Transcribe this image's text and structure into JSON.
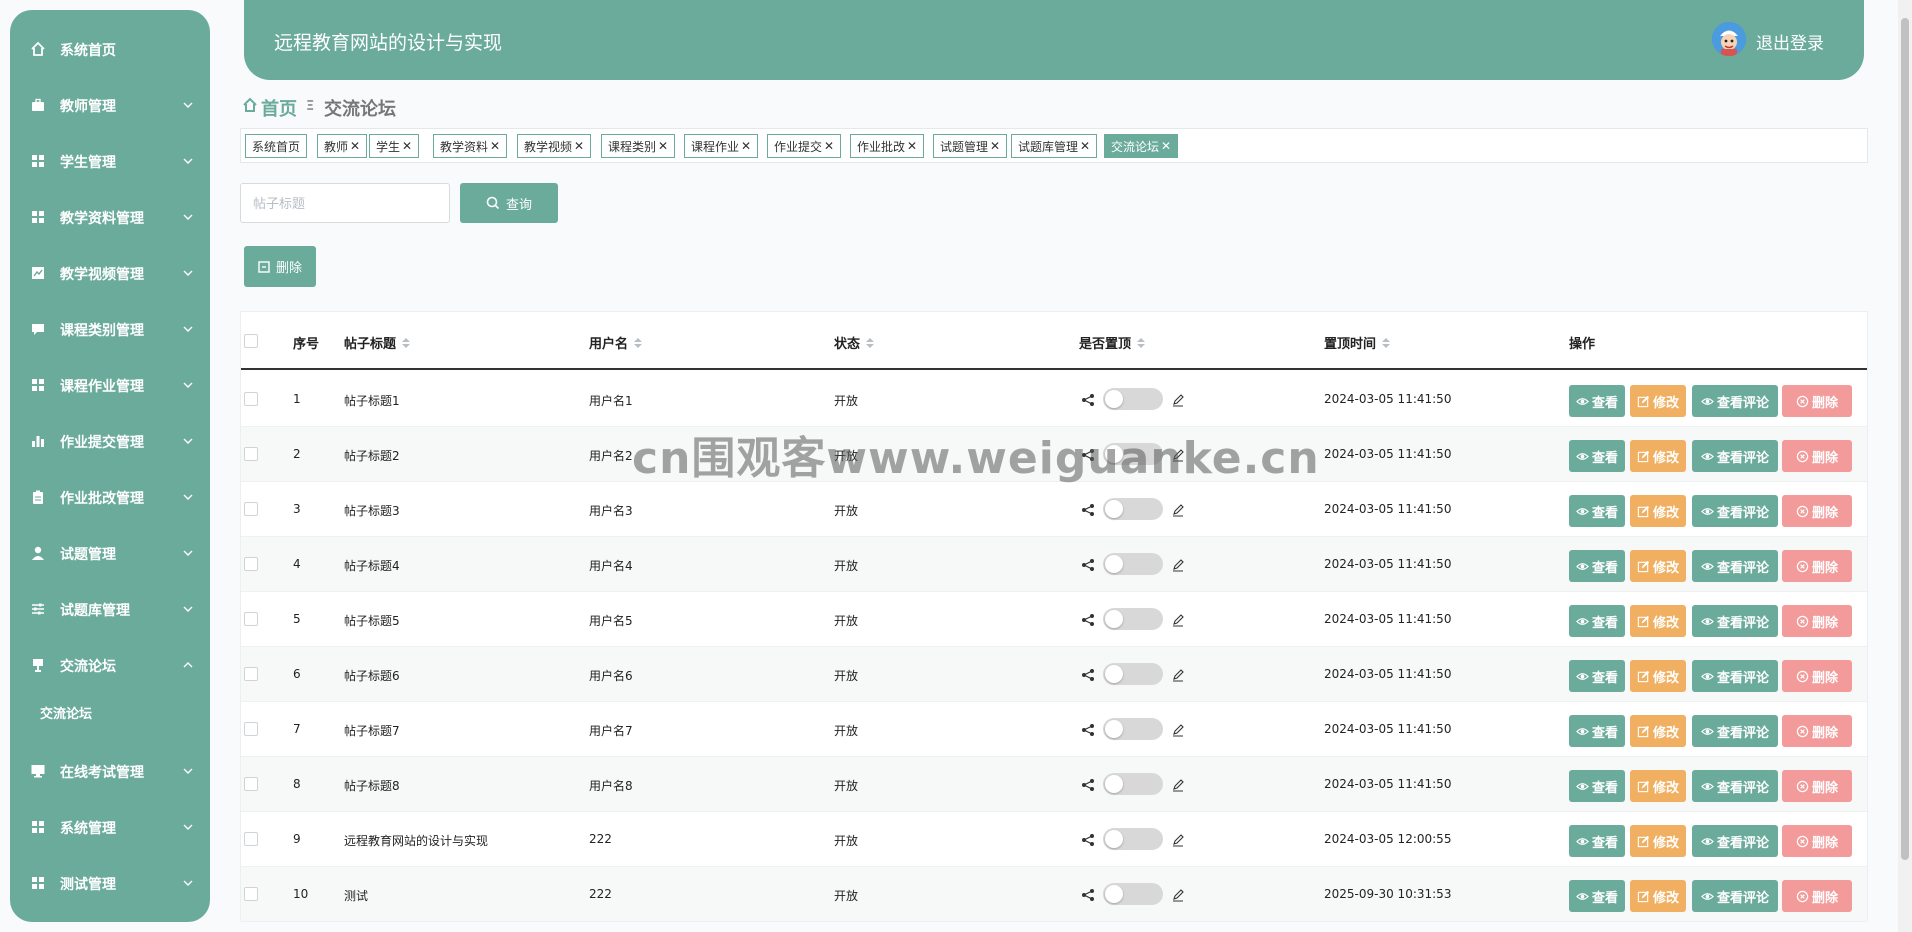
{
  "app": {
    "title": "远程教育网站的设计与实现",
    "logout": "退出登录",
    "accent": "#6aab9c"
  },
  "sidebar": {
    "items": [
      {
        "label": "系统首页",
        "icon": "home-icon"
      },
      {
        "label": "教师管理",
        "icon": "briefcase-icon"
      },
      {
        "label": "学生管理",
        "icon": "grid-icon"
      },
      {
        "label": "教学资料管理",
        "icon": "grid-icon"
      },
      {
        "label": "教学视频管理",
        "icon": "chart-icon"
      },
      {
        "label": "课程类别管理",
        "icon": "chat-icon"
      },
      {
        "label": "课程作业管理",
        "icon": "grid-icon"
      },
      {
        "label": "作业提交管理",
        "icon": "bar-chart-icon"
      },
      {
        "label": "作业批改管理",
        "icon": "clipboard-icon"
      },
      {
        "label": "试题管理",
        "icon": "user-icon"
      },
      {
        "label": "试题库管理",
        "icon": "sliders-icon"
      },
      {
        "label": "交流论坛",
        "icon": "podium-icon",
        "expanded": true
      },
      {
        "label": "在线考试管理",
        "icon": "monitor-icon"
      },
      {
        "label": "系统管理",
        "icon": "grid-icon"
      },
      {
        "label": "测试管理",
        "icon": "grid-icon"
      }
    ],
    "sub_items": [
      {
        "label": "交流论坛"
      }
    ]
  },
  "breadcrumb": {
    "home": "首页",
    "separator": "Ξ",
    "current": "交流论坛"
  },
  "tags": [
    {
      "label": "系统首页",
      "closable": false
    },
    {
      "label": "教师",
      "closable": true
    },
    {
      "label": "学生",
      "closable": true
    },
    {
      "label": "教学资料",
      "closable": true
    },
    {
      "label": "教学视频",
      "closable": true
    },
    {
      "label": "课程类别",
      "closable": true
    },
    {
      "label": "课程作业",
      "closable": true
    },
    {
      "label": "作业提交",
      "closable": true
    },
    {
      "label": "作业批改",
      "closable": true
    },
    {
      "label": "试题管理",
      "closable": true
    },
    {
      "label": "试题库管理",
      "closable": true
    },
    {
      "label": "交流论坛",
      "closable": true,
      "active": true
    }
  ],
  "tag_close": "✕",
  "search": {
    "placeholder": "帖子标题",
    "query_label": "查询"
  },
  "toolbar": {
    "delete_label": "删除"
  },
  "table": {
    "headers": [
      "序号",
      "帖子标题",
      "用户名",
      "状态",
      "是否置顶",
      "置顶时间",
      "操作"
    ],
    "actions": {
      "view": "查看",
      "edit": "修改",
      "comments": "查看评论",
      "delete": "删除"
    },
    "rows": [
      {
        "no": "1",
        "title": "帖子标题1",
        "user": "用户名1",
        "status": "开放",
        "pinned": false,
        "time": "2024-03-05 11:41:50"
      },
      {
        "no": "2",
        "title": "帖子标题2",
        "user": "用户名2",
        "status": "开放",
        "pinned": false,
        "time": "2024-03-05 11:41:50"
      },
      {
        "no": "3",
        "title": "帖子标题3",
        "user": "用户名3",
        "status": "开放",
        "pinned": false,
        "time": "2024-03-05 11:41:50"
      },
      {
        "no": "4",
        "title": "帖子标题4",
        "user": "用户名4",
        "status": "开放",
        "pinned": false,
        "time": "2024-03-05 11:41:50"
      },
      {
        "no": "5",
        "title": "帖子标题5",
        "user": "用户名5",
        "status": "开放",
        "pinned": false,
        "time": "2024-03-05 11:41:50"
      },
      {
        "no": "6",
        "title": "帖子标题6",
        "user": "用户名6",
        "status": "开放",
        "pinned": false,
        "time": "2024-03-05 11:41:50"
      },
      {
        "no": "7",
        "title": "帖子标题7",
        "user": "用户名7",
        "status": "开放",
        "pinned": false,
        "time": "2024-03-05 11:41:50"
      },
      {
        "no": "8",
        "title": "帖子标题8",
        "user": "用户名8",
        "status": "开放",
        "pinned": false,
        "time": "2024-03-05 11:41:50"
      },
      {
        "no": "9",
        "title": "远程教育网站的设计与实现",
        "user": "222",
        "status": "开放",
        "pinned": false,
        "time": "2024-03-05 12:00:55"
      },
      {
        "no": "10",
        "title": "测试",
        "user": "222",
        "status": "开放",
        "pinned": false,
        "time": "2025-09-30 10:31:53"
      }
    ]
  },
  "watermark": "cn围观客www.weiguanke.cn"
}
